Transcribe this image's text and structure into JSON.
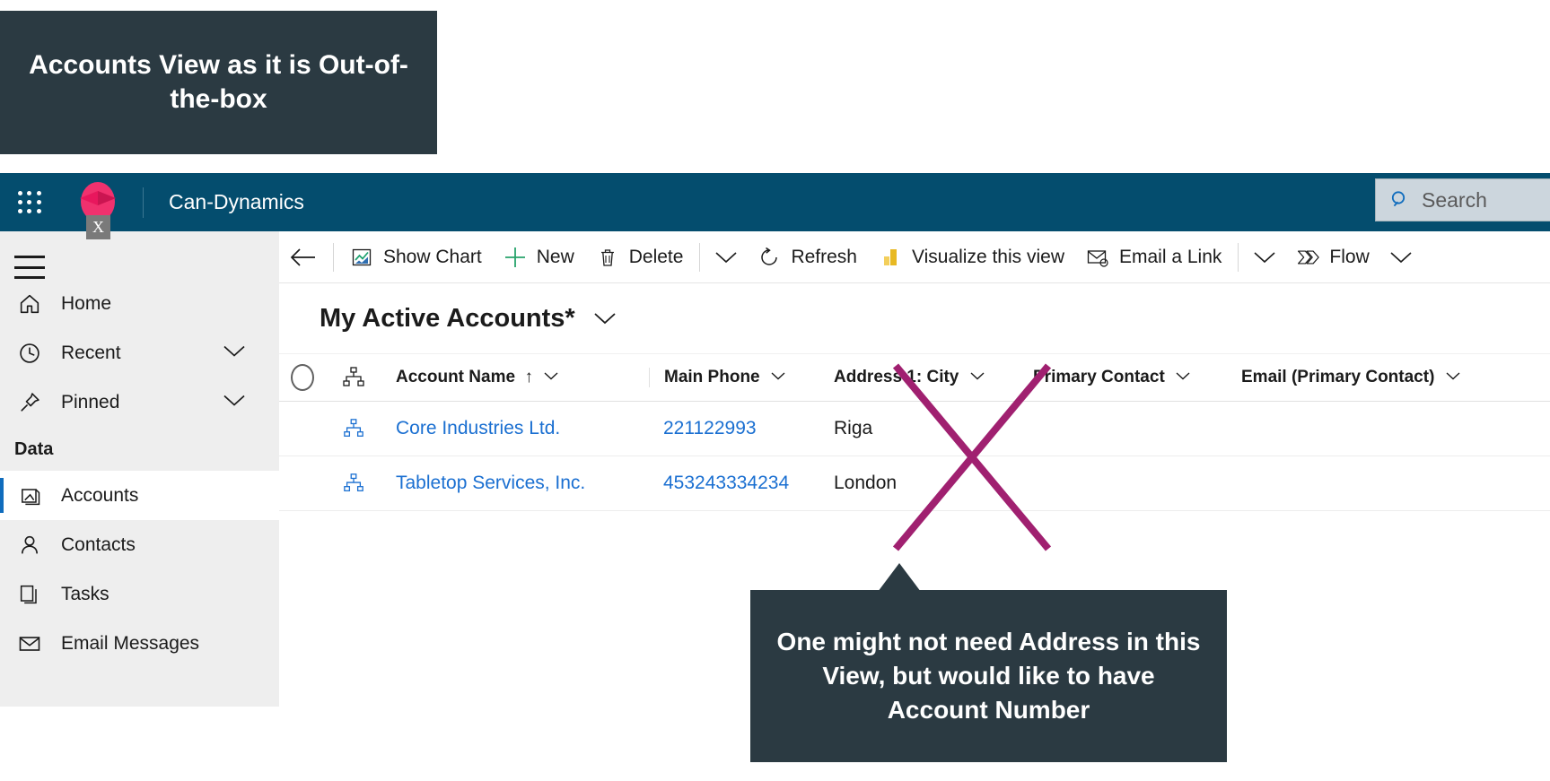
{
  "annotations": {
    "top_callout": "Accounts View as it is Out-of-the-box",
    "bottom_callout": "One might not need Address in this View, but would like to have Account Number",
    "cross_color": "#a02070",
    "callout_bg": "#2b3a42"
  },
  "app_bar": {
    "waffle_icon": "app-launcher-icon",
    "logo_icon": "dynamics-logo",
    "broken_image_badge": "X",
    "app_name": "Can-Dynamics",
    "accent_color": "#044d6e"
  },
  "search": {
    "icon": "search-icon",
    "placeholder": "Search",
    "value": ""
  },
  "sidebar": {
    "menu_icon": "hamburger-icon",
    "items": [
      {
        "label": "Home",
        "icon": "home-icon",
        "expandable": false,
        "selected": false
      },
      {
        "label": "Recent",
        "icon": "clock-icon",
        "expandable": true,
        "selected": false
      },
      {
        "label": "Pinned",
        "icon": "pin-icon",
        "expandable": true,
        "selected": false
      }
    ],
    "group_label": "Data",
    "data_items": [
      {
        "label": "Accounts",
        "icon": "account-icon",
        "selected": true
      },
      {
        "label": "Contacts",
        "icon": "contact-icon",
        "selected": false
      },
      {
        "label": "Tasks",
        "icon": "task-icon",
        "selected": false
      },
      {
        "label": "Email Messages",
        "icon": "envelope-icon",
        "selected": false
      }
    ]
  },
  "command_bar": {
    "back_icon": "back-arrow-icon",
    "commands": [
      {
        "label": "Show Chart",
        "icon": "chart-icon"
      },
      {
        "label": "New",
        "icon": "plus-icon"
      },
      {
        "label": "Delete",
        "icon": "trash-icon"
      },
      {
        "label": "Refresh",
        "icon": "refresh-icon"
      },
      {
        "label": "Visualize this view",
        "icon": "powerbi-icon"
      },
      {
        "label": "Email a Link",
        "icon": "email-link-icon"
      },
      {
        "label": "Flow",
        "icon": "flow-icon"
      }
    ]
  },
  "view": {
    "title": "My Active Accounts*",
    "caret_icon": "chevron-down-icon"
  },
  "grid": {
    "select_all_icon": "select-all-circle",
    "row_type_icon": "hierarchy-icon",
    "columns": [
      {
        "label": "Account Name",
        "sort": "↑",
        "caret": true
      },
      {
        "label": "Main Phone",
        "sort": "",
        "caret": true
      },
      {
        "label": "Address 1: City",
        "sort": "",
        "caret": true
      },
      {
        "label": "Primary Contact",
        "sort": "",
        "caret": true
      },
      {
        "label": "Email (Primary Contact)",
        "sort": "",
        "caret": true
      }
    ],
    "rows": [
      {
        "icon": "hierarchy-icon",
        "account_name": "Core Industries Ltd.",
        "main_phone": "221122993",
        "city": "Riga",
        "primary_contact": "",
        "email": ""
      },
      {
        "icon": "hierarchy-icon",
        "account_name": "Tabletop Services, Inc.",
        "main_phone": "453243334234",
        "city": "London",
        "primary_contact": "",
        "email": ""
      }
    ]
  }
}
